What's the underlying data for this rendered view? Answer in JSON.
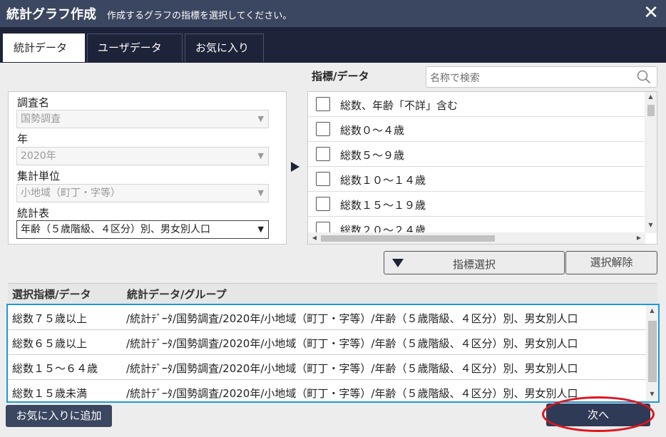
{
  "title": {
    "main": "統計グラフ作成",
    "sub": "作成するグラフの指標を選択してください。"
  },
  "tabs": [
    {
      "label": "統計データ",
      "active": true
    },
    {
      "label": "ユーザデータ",
      "active": false
    },
    {
      "label": "お気に入り",
      "active": false
    }
  ],
  "filters": {
    "survey": {
      "label": "調査名",
      "value": "国勢調査"
    },
    "year": {
      "label": "年",
      "value": "2020年"
    },
    "unit": {
      "label": "集計単位",
      "value": "小地域（町丁・字等）"
    },
    "table": {
      "label": "統計表",
      "value": "年齢（５歳階級、４区分）別、男女別人口"
    }
  },
  "indicators": {
    "label": "指標/データ",
    "search_placeholder": "名称で検索",
    "items": [
      "総数、年齢「不詳」含む",
      "総数０～４歳",
      "総数５～９歳",
      "総数１０～１４歳",
      "総数１５～１９歳",
      "総数２０～２４歳"
    ]
  },
  "buttons": {
    "select": "指標選択",
    "clear": "選択解除",
    "favorite": "お気に入りに追加",
    "next": "次へ"
  },
  "selected": {
    "col1": "選択指標/データ",
    "col2": "統計データ/グループ",
    "rows": [
      {
        "name": "総数７５歳以上",
        "path": "/統計ﾃﾞｰﾀ/国勢調査/2020年/小地域（町丁・字等）/年齢（５歳階級、４区分）別、男女別人口"
      },
      {
        "name": "総数６５歳以上",
        "path": "/統計ﾃﾞｰﾀ/国勢調査/2020年/小地域（町丁・字等）/年齢（５歳階級、４区分）別、男女別人口"
      },
      {
        "name": "総数１５～６４歳",
        "path": "/統計ﾃﾞｰﾀ/国勢調査/2020年/小地域（町丁・字等）/年齢（５歳階級、４区分）別、男女別人口"
      },
      {
        "name": "総数１５歳未満",
        "path": "/統計ﾃﾞｰﾀ/国勢調査/2020年/小地域（町丁・字等）/年齢（５歳階級、４区分）別、男女別人口"
      }
    ]
  },
  "colors": {
    "header": "#3b4660",
    "tabbar": "#1d2339",
    "highlight": "#1f98d9",
    "annotation": "#e0141d"
  }
}
